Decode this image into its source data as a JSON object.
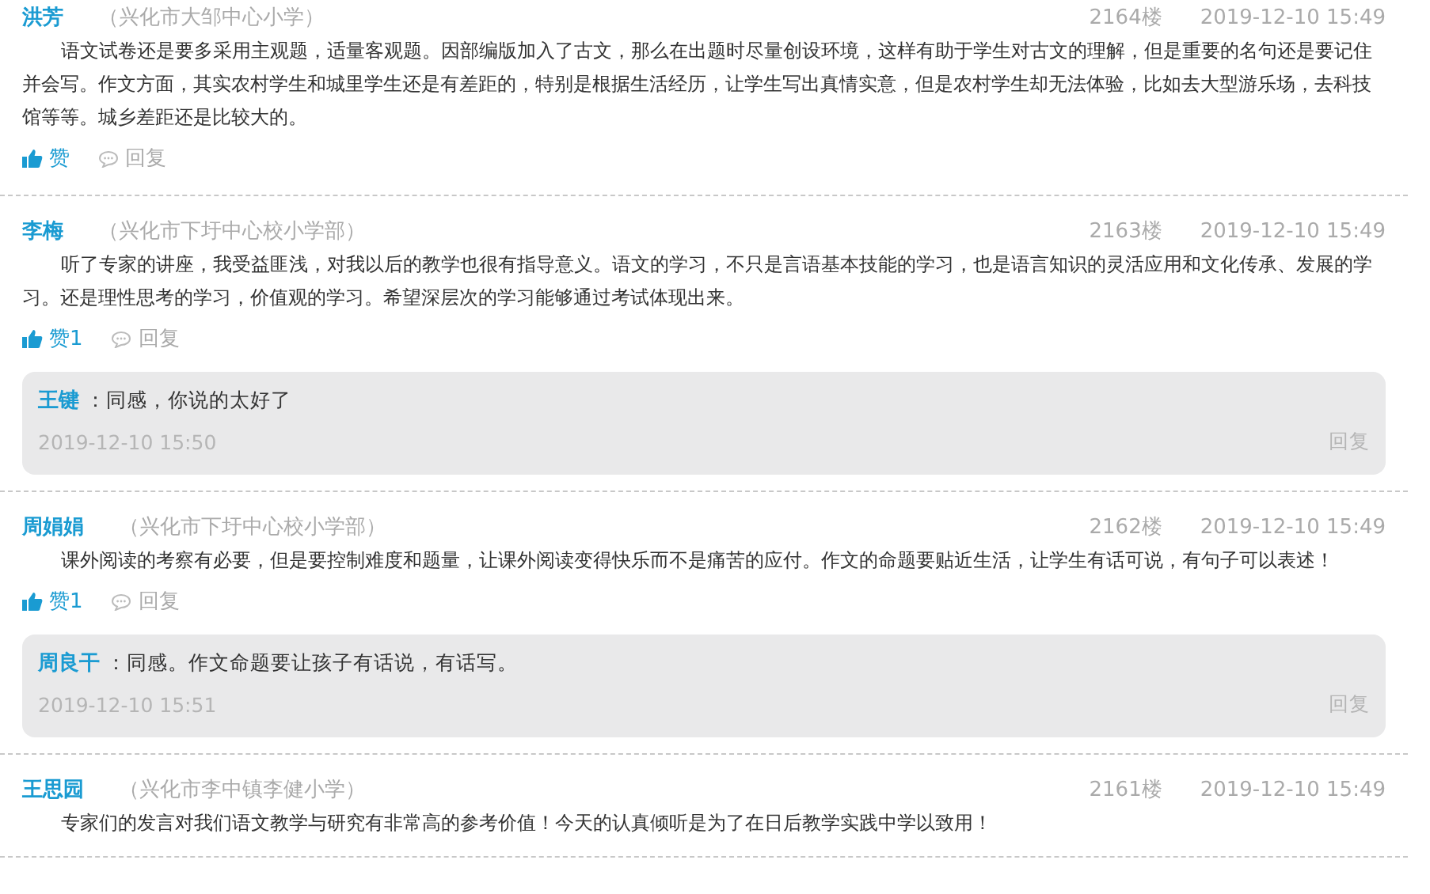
{
  "comments": [
    {
      "author": "洪芳",
      "school": "（兴化市大邹中心小学）",
      "floor": "2164楼",
      "time": "2019-12-10 15:49",
      "body": "语文试卷还是要多采用主观题，适量客观题。因部编版加入了古文，那么在出题时尽量创设环境，这样有助于学生对古文的理解，但是重要的名句还是要记住并会写。作文方面，其实农村学生和城里学生还是有差距的，特别是根据生活经历，让学生写出真情实意，但是农村学生却无法体验，比如去大型游乐场，去科技馆等等。城乡差距还是比较大的。",
      "like": "赞",
      "reply": "回复"
    },
    {
      "author": "李梅",
      "school": "（兴化市下圩中心校小学部）",
      "floor": "2163楼",
      "time": "2019-12-10 15:49",
      "body": "听了专家的讲座，我受益匪浅，对我以后的教学也很有指导意义。语文的学习，不只是言语基本技能的学习，也是语言知识的灵活应用和文化传承、发展的学习。还是理性思考的学习，价值观的学习。希望深层次的学习能够通过考试体现出来。",
      "like": "赞1",
      "reply": "回复",
      "replies": [
        {
          "author": "王键",
          "text": "：同感，你说的太好了",
          "time": "2019-12-10 15:50",
          "reply": "回复"
        }
      ]
    },
    {
      "author": "周娟娟",
      "school": "（兴化市下圩中心校小学部）",
      "floor": "2162楼",
      "time": "2019-12-10 15:49",
      "body": "课外阅读的考察有必要，但是要控制难度和题量，让课外阅读变得快乐而不是痛苦的应付。作文的命题要贴近生活，让学生有话可说，有句子可以表述！",
      "like": "赞1",
      "reply": "回复",
      "replies": [
        {
          "author": "周良干",
          "text": "：同感。作文命题要让孩子有话说，有话写。",
          "time": "2019-12-10 15:51",
          "reply": "回复"
        }
      ]
    },
    {
      "author": "王思园",
      "school": "（兴化市李中镇李健小学）",
      "floor": "2161楼",
      "time": "2019-12-10 15:49",
      "body": "专家们的发言对我们语文教学与研究有非常高的参考价值！今天的认真倾听是为了在日后教学实践中学以致用！"
    }
  ]
}
